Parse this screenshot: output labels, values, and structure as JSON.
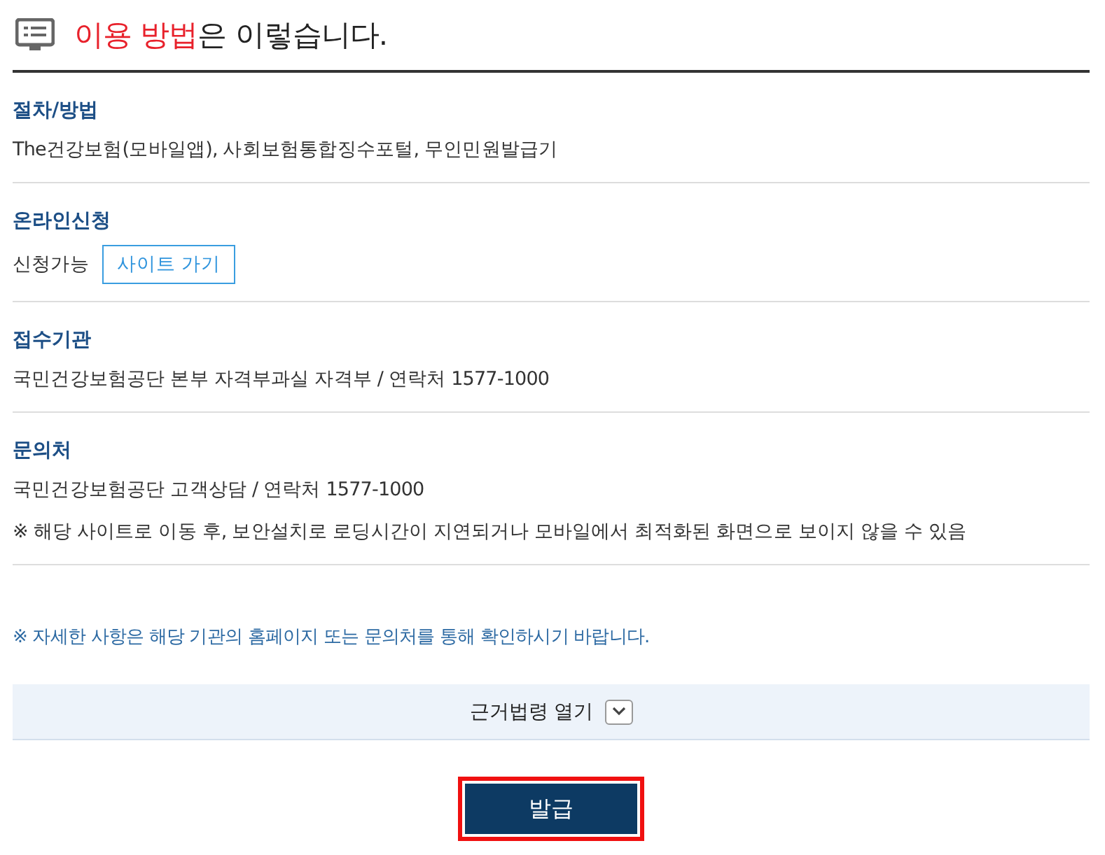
{
  "heading": {
    "highlight": "이용 방법",
    "rest": "은 이렇습니다."
  },
  "sections": [
    {
      "kind": "text",
      "label": "절차/방법",
      "lines": [
        "The건강보험(모바일앱), 사회보험통합징수포털, 무인민원발급기"
      ]
    },
    {
      "kind": "link",
      "label": "온라인신청",
      "lines": [
        "신청가능"
      ],
      "link": "사이트 가기"
    },
    {
      "kind": "text",
      "label": "접수기관",
      "lines": [
        "국민건강보험공단 본부 자격부과실 자격부 / 연락처 1577-1000"
      ]
    },
    {
      "kind": "text",
      "label": "문의처",
      "lines": [
        "국민건강보험공단 고객상담 / 연락처 1577-1000",
        "※ 해당 사이트로 이동 후, 보안설치로 로딩시간이 지연되거나 모바일에서 최적화된 화면으로 보이지 않을 수 있음"
      ]
    }
  ],
  "note": "※ 자세한 사항은 해당 기관의 홈페이지 또는 문의처를 통해 확인하시기 바랍니다.",
  "law_toggle": {
    "label": "근거법령 열기",
    "expanded": false
  },
  "issue_button": {
    "label": "발급",
    "highlighted": true
  }
}
